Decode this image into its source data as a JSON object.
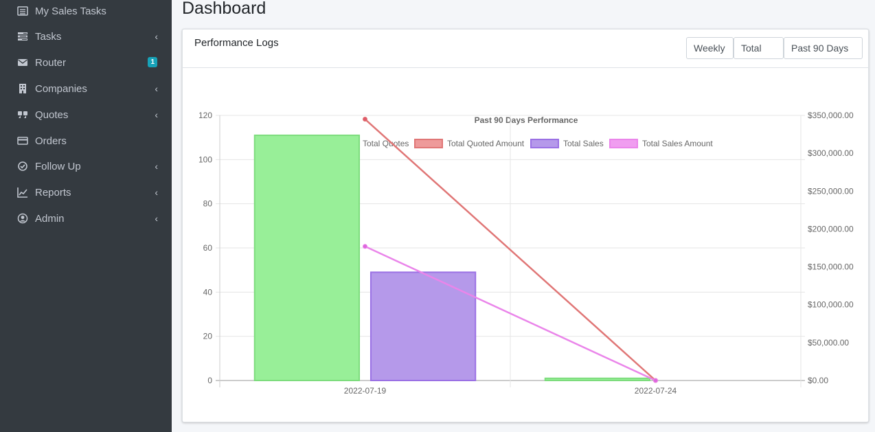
{
  "sidebar": {
    "items": [
      {
        "label": "My Sales Tasks",
        "icon": "list-icon",
        "chevron": false
      },
      {
        "label": "Tasks",
        "icon": "tasks-icon",
        "chevron": true
      },
      {
        "label": "Router",
        "icon": "envelope-icon",
        "chevron": false,
        "badge": "1"
      },
      {
        "label": "Companies",
        "icon": "building-icon",
        "chevron": true
      },
      {
        "label": "Quotes",
        "icon": "quote-icon",
        "chevron": true
      },
      {
        "label": "Orders",
        "icon": "credit-card-icon",
        "chevron": false
      },
      {
        "label": "Follow Up",
        "icon": "check-circle-icon",
        "chevron": true
      },
      {
        "label": "Reports",
        "icon": "line-chart-icon",
        "chevron": true
      },
      {
        "label": "Admin",
        "icon": "user-circle-icon",
        "chevron": true
      }
    ],
    "chevron_glyph": "‹"
  },
  "header": {
    "title": "Dashboard"
  },
  "card": {
    "title": "Performance Logs",
    "buttons": {
      "period": "Weekly",
      "metric": "Total",
      "range": "Past 90 Days"
    }
  },
  "chart_data": {
    "type": "bar",
    "title": "Past 90 Days Performance",
    "categories": [
      "2022-07-19",
      "2022-07-24"
    ],
    "y_left": {
      "ticks": [
        "0",
        "20",
        "40",
        "60",
        "80",
        "100",
        "120"
      ],
      "min": 0,
      "max": 120
    },
    "y_right": {
      "ticks": [
        "$0.00",
        "$50,000.00",
        "$100,000.00",
        "$150,000.00",
        "$200,000.00",
        "$250,000.00",
        "$300,000.00",
        "$350,000.00"
      ],
      "min": 0,
      "max": 350000
    },
    "grid": true,
    "legend_position": "top",
    "series": [
      {
        "name": "Total Quotes",
        "kind": "bar",
        "axis": "left",
        "values": [
          111,
          1
        ],
        "fill": "#98ef98",
        "stroke": "#7ddc7d"
      },
      {
        "name": "Total Quoted Amount",
        "kind": "line",
        "axis": "right",
        "values": [
          345000,
          0
        ],
        "fill": "#ee9a9a",
        "stroke": "#e07676",
        "point": "#e05a6a"
      },
      {
        "name": "Total Sales",
        "kind": "bar",
        "axis": "left",
        "values": [
          49,
          0
        ],
        "fill": "#b599ea",
        "stroke": "#9a70e4"
      },
      {
        "name": "Total Sales Amount",
        "kind": "line",
        "axis": "right",
        "values": [
          177000,
          0
        ],
        "fill": "#f09df0",
        "stroke": "#ea85ea",
        "point": "#dd66dd"
      }
    ]
  }
}
